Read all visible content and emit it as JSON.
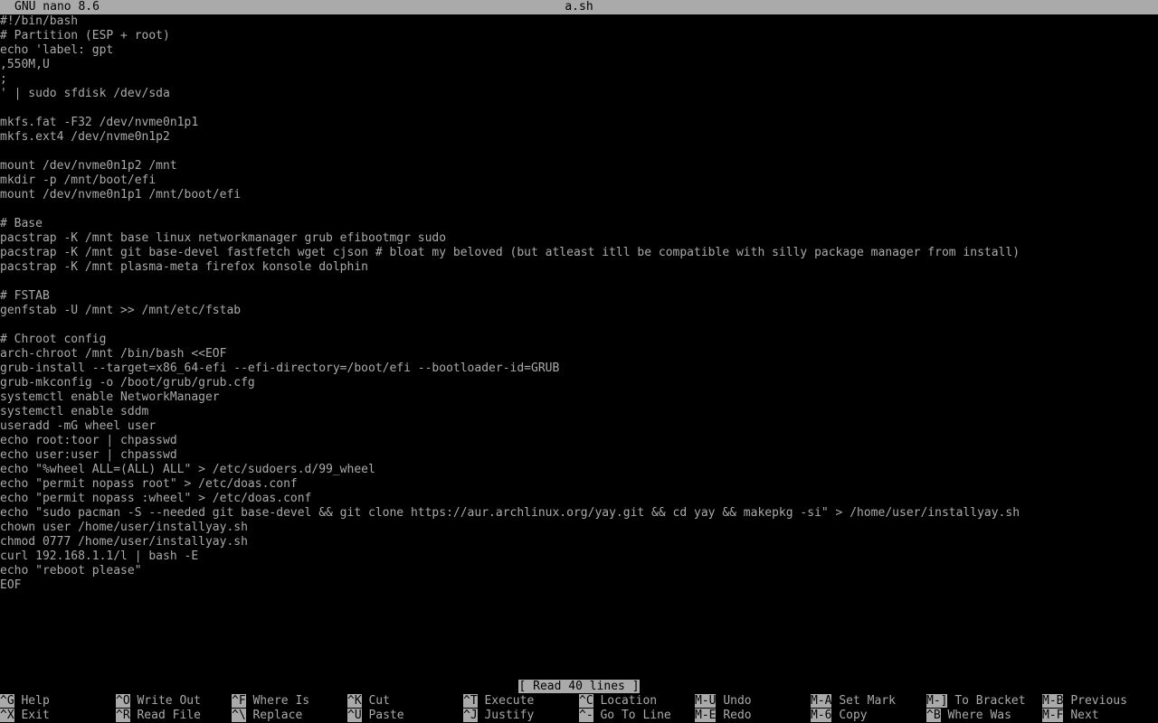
{
  "title_bar": {
    "app": "GNU nano 8.6",
    "filename": "a.sh"
  },
  "editor": {
    "lines": [
      "#!/bin/bash",
      "# Partition (ESP + root)",
      "echo 'label: gpt",
      ",550M,U",
      ";",
      "' | sudo sfdisk /dev/sda",
      "",
      "mkfs.fat -F32 /dev/nvme0n1p1",
      "mkfs.ext4 /dev/nvme0n1p2",
      "",
      "mount /dev/nvme0n1p2 /mnt",
      "mkdir -p /mnt/boot/efi",
      "mount /dev/nvme0n1p1 /mnt/boot/efi",
      "",
      "# Base",
      "pacstrap -K /mnt base linux networkmanager grub efibootmgr sudo",
      "pacstrap -K /mnt git base-devel fastfetch wget cjson # bloat my beloved (but atleast itll be compatible with silly package manager from install)",
      "pacstrap -K /mnt plasma-meta firefox konsole dolphin",
      "",
      "# FSTAB",
      "genfstab -U /mnt >> /mnt/etc/fstab",
      "",
      "# Chroot config",
      "arch-chroot /mnt /bin/bash <<EOF",
      "grub-install --target=x86_64-efi --efi-directory=/boot/efi --bootloader-id=GRUB",
      "grub-mkconfig -o /boot/grub/grub.cfg",
      "systemctl enable NetworkManager",
      "systemctl enable sddm",
      "useradd -mG wheel user",
      "echo root:toor | chpasswd",
      "echo user:user | chpasswd",
      "echo \"%wheel ALL=(ALL) ALL\" > /etc/sudoers.d/99_wheel",
      "echo \"permit nopass root\" > /etc/doas.conf",
      "echo \"permit nopass :wheel\" > /etc/doas.conf",
      "echo \"sudo pacman -S --needed git base-devel && git clone https://aur.archlinux.org/yay.git && cd yay && makepkg -si\" > /home/user/installyay.sh",
      "chown user /home/user/installyay.sh",
      "chmod 0777 /home/user/installyay.sh",
      "curl 192.168.1.1/l | bash -E",
      "echo \"reboot please\"",
      "EOF"
    ]
  },
  "status": {
    "message": "[ Read 40 lines ]"
  },
  "shortcuts": {
    "row1": [
      {
        "key": "^G",
        "label": "Help"
      },
      {
        "key": "^O",
        "label": "Write Out"
      },
      {
        "key": "^F",
        "label": "Where Is"
      },
      {
        "key": "^K",
        "label": "Cut"
      },
      {
        "key": "^T",
        "label": "Execute"
      },
      {
        "key": "^C",
        "label": "Location"
      },
      {
        "key": "M-U",
        "label": "Undo"
      },
      {
        "key": "M-A",
        "label": "Set Mark"
      },
      {
        "key": "M-]",
        "label": "To Bracket"
      },
      {
        "key": "M-B",
        "label": "Previous"
      }
    ],
    "row2": [
      {
        "key": "^X",
        "label": "Exit"
      },
      {
        "key": "^R",
        "label": "Read File"
      },
      {
        "key": "^\\",
        "label": "Replace"
      },
      {
        "key": "^U",
        "label": "Paste"
      },
      {
        "key": "^J",
        "label": "Justify"
      },
      {
        "key": "^-",
        "label": "Go To Line"
      },
      {
        "key": "M-E",
        "label": "Redo"
      },
      {
        "key": "M-6",
        "label": "Copy"
      },
      {
        "key": "^B",
        "label": "Where Was"
      },
      {
        "key": "M-F",
        "label": "Next"
      }
    ]
  },
  "colors": {
    "background": "#000000",
    "foreground": "#aaaaaa",
    "inverse_bg": "#aaaaaa",
    "inverse_fg": "#000000"
  }
}
